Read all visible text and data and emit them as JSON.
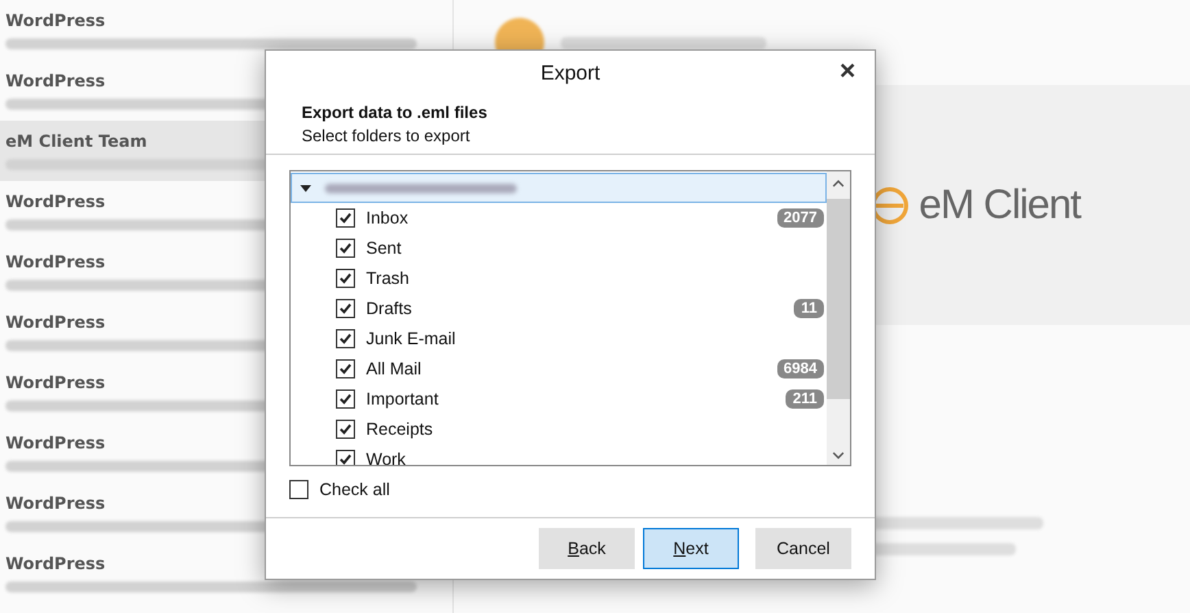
{
  "background": {
    "message_list": [
      {
        "sender": "WordPress",
        "selected": false
      },
      {
        "sender": "WordPress",
        "selected": false
      },
      {
        "sender": "eM Client Team",
        "selected": true
      },
      {
        "sender": "WordPress",
        "selected": false
      },
      {
        "sender": "WordPress",
        "selected": false
      },
      {
        "sender": "WordPress",
        "selected": false
      },
      {
        "sender": "WordPress",
        "selected": false
      },
      {
        "sender": "WordPress",
        "selected": false
      },
      {
        "sender": "WordPress",
        "selected": false
      },
      {
        "sender": "WordPress",
        "selected": false
      }
    ],
    "reading_pane": {
      "logo": "eM Client"
    }
  },
  "dialog": {
    "title": "Export",
    "close": "×",
    "heading": "Export data to .eml files",
    "subheading": "Select folders to export",
    "tree": [
      {
        "expanded": true,
        "selected": true,
        "children": [
          {
            "name": "Inbox",
            "checked": true,
            "count": "2077"
          },
          {
            "name": "Sent",
            "checked": true
          },
          {
            "name": "Trash",
            "checked": true
          },
          {
            "name": "Drafts",
            "checked": true,
            "count": "11"
          },
          {
            "name": "Junk E-mail",
            "checked": true
          },
          {
            "name": "All Mail",
            "checked": true,
            "count": "6984"
          },
          {
            "name": "Important",
            "checked": true,
            "count": "211"
          },
          {
            "name": "Receipts",
            "checked": true
          },
          {
            "name": "Work",
            "checked": true
          }
        ]
      }
    ],
    "check_all": {
      "label": "Check all",
      "checked": false
    },
    "buttons": [
      {
        "label": "Back",
        "mnemonic": true,
        "kind": "secondary"
      },
      {
        "label": "Next",
        "mnemonic": true,
        "kind": "primary"
      },
      {
        "label": "Cancel",
        "mnemonic": false,
        "kind": "secondary"
      }
    ]
  }
}
